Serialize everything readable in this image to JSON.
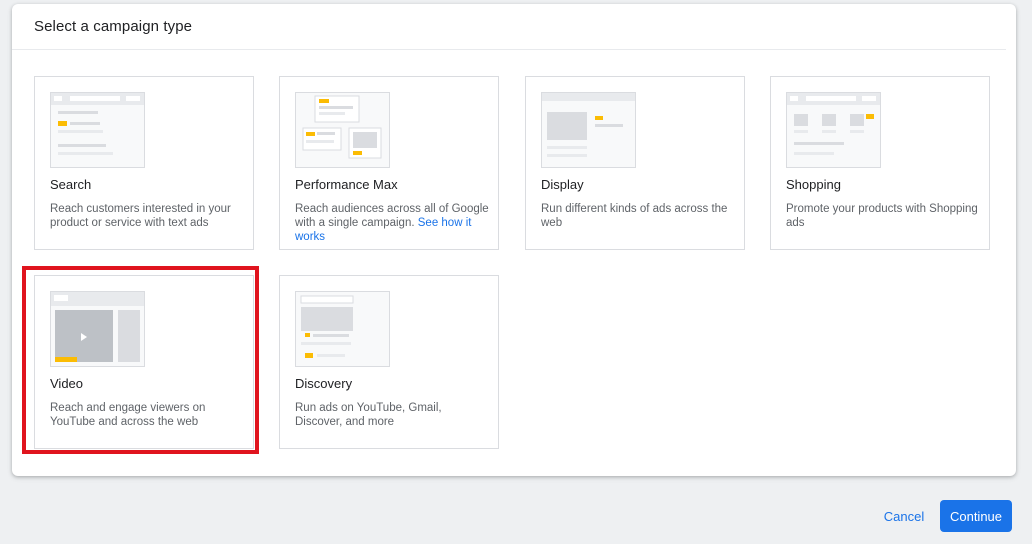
{
  "dialog": {
    "title": "Select a campaign type"
  },
  "campaign_types": [
    {
      "name": "Search",
      "description": "Reach customers interested in your product or service with text ads",
      "icon": "search-ad-illustration"
    },
    {
      "name": "Performance Max",
      "description": "Reach audiences across all of Google with a single campaign.",
      "link_text": "See how it works",
      "icon": "performance-max-illustration"
    },
    {
      "name": "Display",
      "description": "Run different kinds of ads across the web",
      "icon": "display-ad-illustration"
    },
    {
      "name": "Shopping",
      "description": "Promote your products with Shopping ads",
      "icon": "shopping-ad-illustration"
    },
    {
      "name": "Video",
      "description": "Reach and engage viewers on YouTube and across the web",
      "icon": "video-ad-illustration",
      "highlighted": true
    },
    {
      "name": "Discovery",
      "description": "Run ads on YouTube, Gmail, Discover, and more",
      "icon": "discovery-ad-illustration"
    }
  ],
  "footer": {
    "cancel_label": "Cancel",
    "continue_label": "Continue"
  },
  "colors": {
    "accent": "#1a73e8",
    "highlight": "#e0141e",
    "ad_badge": "#fbbc04"
  }
}
